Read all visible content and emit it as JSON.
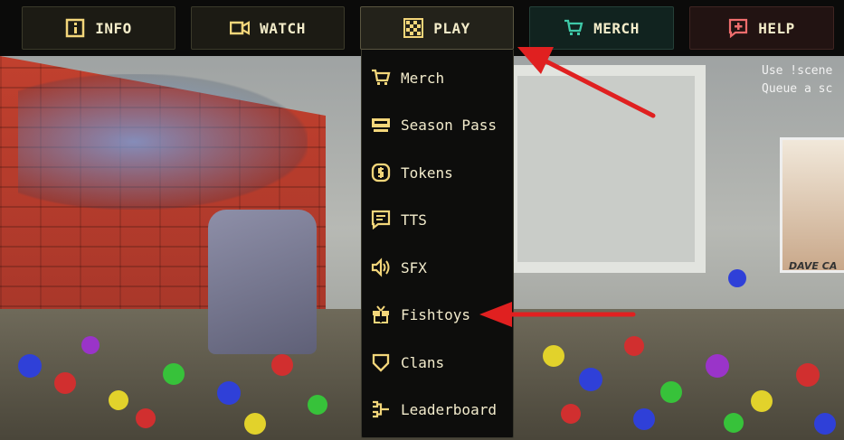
{
  "nav": {
    "info_label": "INFO",
    "watch_label": "WATCH",
    "play_label": "PLAY",
    "merch_label": "MERCH",
    "help_label": "HELP"
  },
  "menu": {
    "items": [
      {
        "label": "Merch",
        "icon": "cart-icon"
      },
      {
        "label": "Season Pass",
        "icon": "ticket-icon"
      },
      {
        "label": "Tokens",
        "icon": "coin-icon"
      },
      {
        "label": "TTS",
        "icon": "chat-icon"
      },
      {
        "label": "SFX",
        "icon": "speaker-icon"
      },
      {
        "label": "Fishtoys",
        "icon": "gift-icon"
      },
      {
        "label": "Clans",
        "icon": "shield-icon"
      },
      {
        "label": "Leaderboard",
        "icon": "bracket-icon"
      }
    ]
  },
  "scene": {
    "hint_text": "Use !scene\nQueue a sc",
    "poster_text": "DAVE CA"
  },
  "colors": {
    "icon_gold": "#f3d67a",
    "merch_teal": "#3fc9a8",
    "help_red": "#ef6d6d",
    "arrow_red": "#e02020"
  }
}
